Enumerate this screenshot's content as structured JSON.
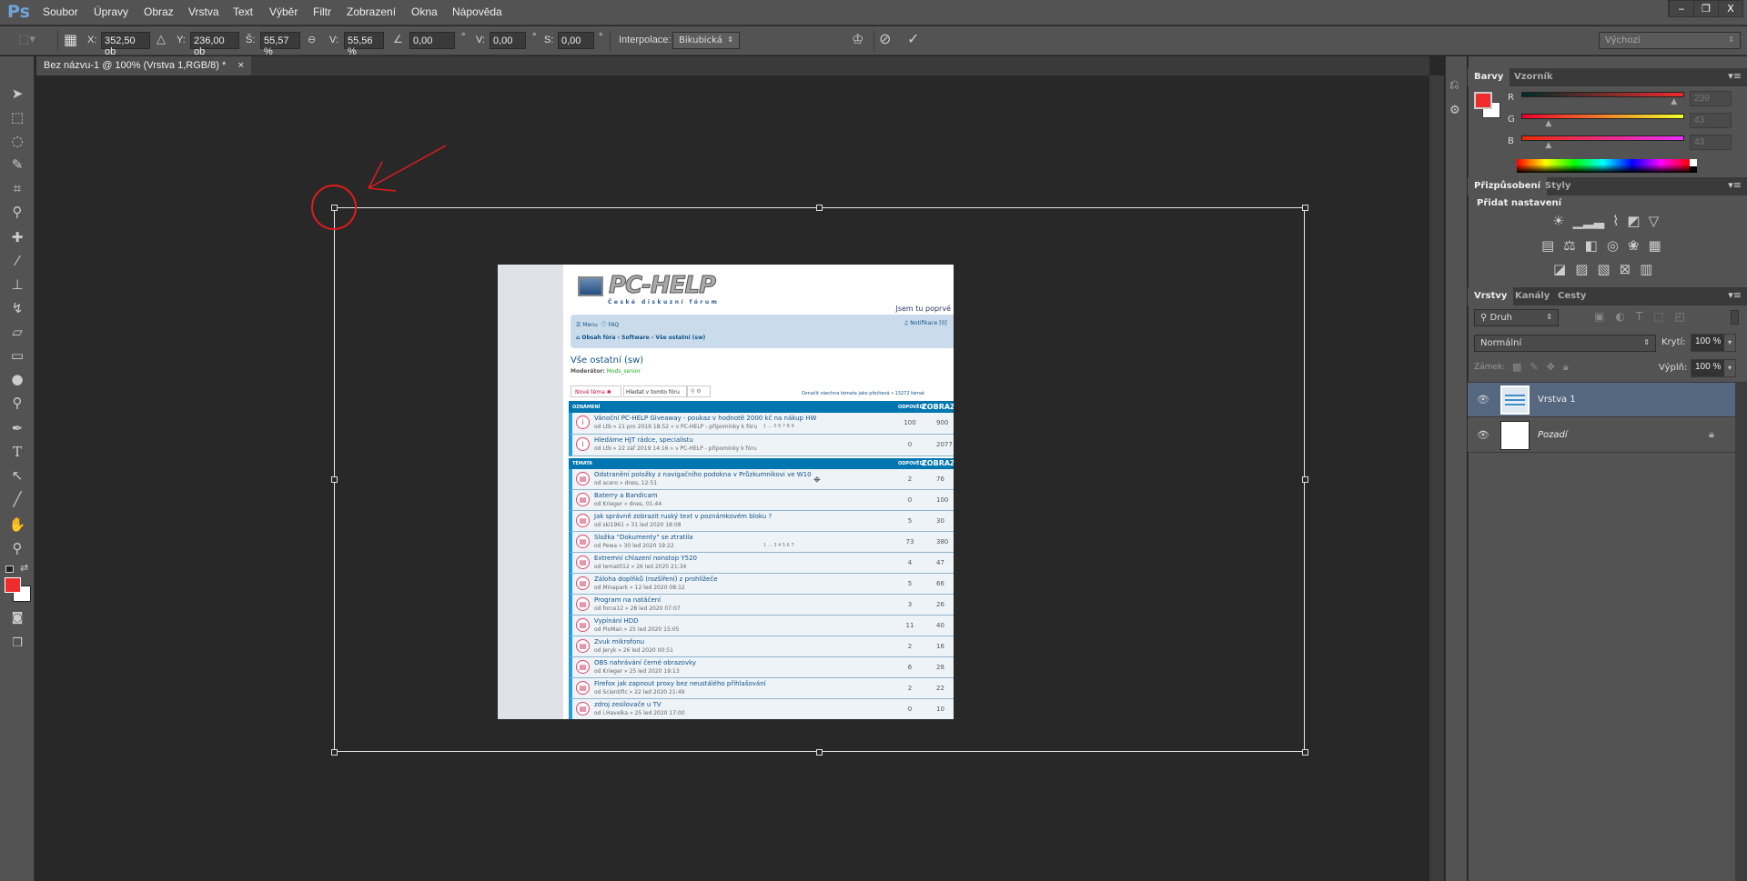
{
  "app": {
    "logo": "Ps",
    "menu": [
      "Soubor",
      "Úpravy",
      "Obraz",
      "Vrstva",
      "Text",
      "Výběr",
      "Filtr",
      "Zobrazení",
      "Okna",
      "Nápověda"
    ],
    "window_controls": [
      "‒",
      "❐",
      "X"
    ]
  },
  "options": {
    "x_label": "X:",
    "x": "352,50 ob",
    "y_label": "Y:",
    "y": "236,00 ob",
    "w_label": "Š:",
    "w": "55,57 %",
    "h_label": "V:",
    "h": "55,56 %",
    "angle": "0,00",
    "deg": "°",
    "hskew_label": "V:",
    "hskew": "0,00",
    "vskew_label": "S:",
    "vskew": "0,00",
    "interp_label": "Interpolace:",
    "interp": "Bikubická",
    "workspace": "Výchozí"
  },
  "document": {
    "tab": "Bez názvu-1 @ 100% (Vrstva 1,RGB/8) *",
    "close": "×"
  },
  "colors_panel": {
    "tabs": [
      "Barvy",
      "Vzorník"
    ],
    "r_label": "R",
    "g_label": "G",
    "b_label": "B",
    "r": "239",
    "g": "43",
    "b": "43",
    "foreground": "#ef2b2b",
    "background": "#ffffff",
    "r_frac": 0.94,
    "g_frac": 0.17,
    "b_frac": 0.17
  },
  "adjust_panel": {
    "tabs": [
      "Přizpůsobení",
      "Styly"
    ],
    "title": "Přidat nastavení"
  },
  "layers_panel": {
    "tabs": [
      "Vrstvy",
      "Kanály",
      "Cesty"
    ],
    "filter": "Druh",
    "blend": "Normální",
    "opacity_label": "Krytí:",
    "opacity": "100 %",
    "lock_label": "Zámek:",
    "fill_label": "Výplň:",
    "fill": "100 %",
    "layers": [
      {
        "name": "Vrstva 1",
        "selected": true
      },
      {
        "name": "Pozadí",
        "locked": true
      }
    ]
  },
  "forum": {
    "logo": "PC-HELP",
    "logo_sub": "České diskuzní fórum",
    "first_visit": "Jsem tu poprvé",
    "nav_menu": "Menu",
    "nav_faq": "FAQ",
    "notifications": "Notifikace [0]",
    "breadcrumb": [
      "Obsah fóra",
      "Software",
      "Vše ostatní (sw)"
    ],
    "title": "Vše ostatní (sw)",
    "moderator_label": "Moderátor:",
    "moderator": "Mods_senior",
    "new_topic": "Nové téma",
    "search_placeholder": "Hledat v tomto fóru",
    "mark_read": "Označit všechna témata jako přečtená • 13272 témat",
    "ann_header": "OZNÁMENÍ",
    "topics_header": "TÉMATA",
    "replies_header": "ODPOVĚDI",
    "views_header": "ZOBRAZ",
    "announcements": [
      {
        "title": "Vánoční PC-HELP Giveaway - poukaz v hodnotě 2000 kč na nákup HW",
        "meta": "od Ltb » 21 pro 2019 18:52 » v PC-HELP - připomínky k fóru",
        "pages": "1 … 5 6 7 8 9",
        "replies": "100",
        "views": "900"
      },
      {
        "title": "Hledáme HJT rádce, specialistu",
        "meta": "od Ltb » 22 zář 2019 14:16 » v PC-HELP - připomínky k fóru",
        "replies": "0",
        "views": "2077"
      }
    ],
    "topics": [
      {
        "title": "Odstranění položky z navigačního podokna v Průzkumníkovi ve W10",
        "meta": "od acero » dnes, 12:51",
        "replies": "2",
        "views": "76"
      },
      {
        "title": "Baterry a Bandicam",
        "meta": "od Krieger » dnes, 01:44",
        "replies": "0",
        "views": "100"
      },
      {
        "title": "Jak správně zobrazit ruský text v poznámkovém bloku ?",
        "meta": "od ski1961 » 31 led 2020 18:08",
        "replies": "5",
        "views": "30"
      },
      {
        "title": "Složka \"Dokumenty\" se ztratila",
        "meta": "od Pewa » 30 led 2020 19:22",
        "pages": "1 … 3 4 5 6 7",
        "replies": "73",
        "views": "380"
      },
      {
        "title": "Extremní chlazení nonstop Y520",
        "meta": "od temat012 » 26 led 2020 21:34",
        "replies": "4",
        "views": "47"
      },
      {
        "title": "Záloha doplňků (rozšíření) z prohlížeče",
        "meta": "od Minapark » 12 led 2020 08:12",
        "replies": "5",
        "views": "66"
      },
      {
        "title": "Program na natáčení",
        "meta": "od force12 » 28 led 2020 07:07",
        "replies": "3",
        "views": "26"
      },
      {
        "title": "Vypínání HDD",
        "meta": "od PioMan » 25 led 2020 15:05",
        "replies": "11",
        "views": "40"
      },
      {
        "title": "Zvuk mikrofonu",
        "meta": "od Jeryk » 26 led 2020 00:51",
        "replies": "2",
        "views": "16"
      },
      {
        "title": "OBS nahrávání černé obrazovky",
        "meta": "od Krieger » 25 led 2020 19:13",
        "replies": "6",
        "views": "28"
      },
      {
        "title": "Firefox jak zapnout proxy bez neustálého přihlašování",
        "meta": "od Scientific » 22 led 2020 21:49",
        "replies": "2",
        "views": "22"
      },
      {
        "title": "zdroj zesilovače u TV",
        "meta": "od i.Havelka » 25 led 2020 17:00",
        "replies": "0",
        "views": "10"
      }
    ]
  }
}
